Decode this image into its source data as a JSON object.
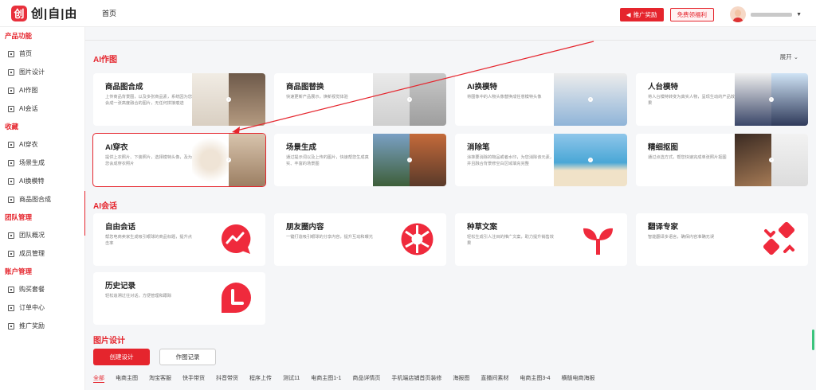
{
  "header": {
    "logo_mark": "创",
    "logo_text": "创|自|由",
    "page_title": "首页",
    "promo_label": "推广奖励",
    "coupon_label": "免费领福利"
  },
  "sidebar": {
    "groups": [
      {
        "title": "产品功能",
        "items": [
          "首页",
          "图片设计",
          "AI作图",
          "AI会话"
        ]
      },
      {
        "title": "收藏",
        "items": [
          "AI穿衣",
          "场景生成",
          "AI换模特",
          "商品图合成"
        ]
      },
      {
        "title": "团队管理",
        "items": [
          "团队概况",
          "成员管理"
        ]
      },
      {
        "title": "账户管理",
        "items": [
          "购买套餐",
          "订单中心",
          "推广奖励"
        ]
      }
    ]
  },
  "ai_draw": {
    "title": "AI作图",
    "expand_label": "展开 ⌄",
    "cards": [
      {
        "title": "商品图合成",
        "desc": "上传商品背景图，以及多张商品素，系统因为您会成一张高度融合的图片，无任何拼接痕迹"
      },
      {
        "title": "商品图替换",
        "desc": "快速更新产品展示，焕新视觉体验"
      },
      {
        "title": "AI换模特",
        "desc": "将图像中的人物头像替换成任意模特头像"
      },
      {
        "title": "人台模特",
        "desc": "将人台模特转变为真实人物，呈现生动的产品效果"
      },
      {
        "title": "AI穿衣",
        "desc": "提供上衣照片、下装照片，选择模特头像，及为您会成穿衣照片"
      },
      {
        "title": "场景生成",
        "desc": "通过提示词以及上传的图片，快速帮您生成真实、丰富的场景图"
      },
      {
        "title": "消除笔",
        "desc": "涂抹要消除的物品或者水印，为您消除该元素，并且融合背景修空白区域填充完整"
      },
      {
        "title": "精细抠图",
        "desc": "通过点选方式，帮您快速完成单张照片抠图"
      }
    ]
  },
  "ai_chat": {
    "title": "AI会话",
    "cards": [
      {
        "title": "自由会话",
        "desc": "帮您电商卖家生成吸引眼球的商品标题，提升点击率"
      },
      {
        "title": "朋友圈内容",
        "desc": "一键打造吸引眼球的分享内容，提升互动和曝光"
      },
      {
        "title": "种草文案",
        "desc": "轻松生成引人注目的推广文案，助力提升销售效果"
      },
      {
        "title": "翻译专家",
        "desc": "智能翻译多语言，确保内容准确无误"
      },
      {
        "title": "历史记录",
        "desc": "轻松追溯过往对话，方便管理和跟踪"
      }
    ]
  },
  "design": {
    "title": "图片设计",
    "create_label": "创建设计",
    "records_label": "作图记录",
    "tags": [
      "全部",
      "电商主图",
      "淘宝客服",
      "快手带货",
      "抖音带货",
      "程序上传",
      "测试11",
      "电商主图1-1",
      "商品详情页",
      "手机端店铺首页装修",
      "海报图",
      "直播间素材",
      "电商主图3-4",
      "横版电商海报"
    ]
  },
  "colors": {
    "accent": "#e5252d",
    "background": "#f5f6f8"
  }
}
